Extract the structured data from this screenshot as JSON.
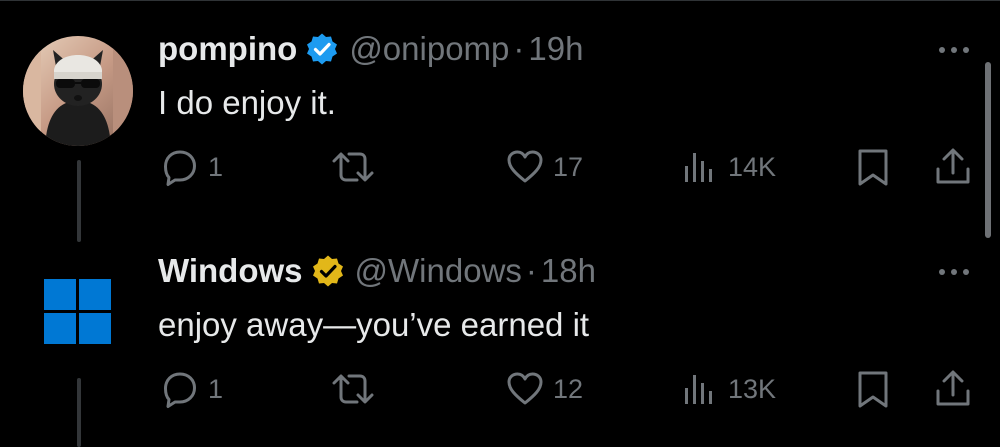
{
  "tweets": [
    {
      "display_name": "pompino",
      "badge": "blue-verified",
      "handle": "@onipomp",
      "separator": "·",
      "time": "19h",
      "text": "I do enjoy it.",
      "avatar": "cat-with-beanie-and-sunglasses",
      "actions": {
        "replies": "1",
        "reposts": "",
        "likes": "17",
        "views": "14K"
      }
    },
    {
      "display_name": "Windows",
      "badge": "gold-verified",
      "handle": "@Windows",
      "separator": "·",
      "time": "18h",
      "text": "enjoy away—you’ve earned it",
      "avatar": "windows-logo",
      "actions": {
        "replies": "1",
        "reposts": "",
        "likes": "12",
        "views": "13K"
      }
    }
  ],
  "colors": {
    "background": "#000000",
    "primary_text": "#e7e9ea",
    "secondary_text": "#71767b",
    "verified_blue": "#1d9bf0",
    "verified_gold": "#e2b719",
    "windows_blue": "#0078d4"
  }
}
